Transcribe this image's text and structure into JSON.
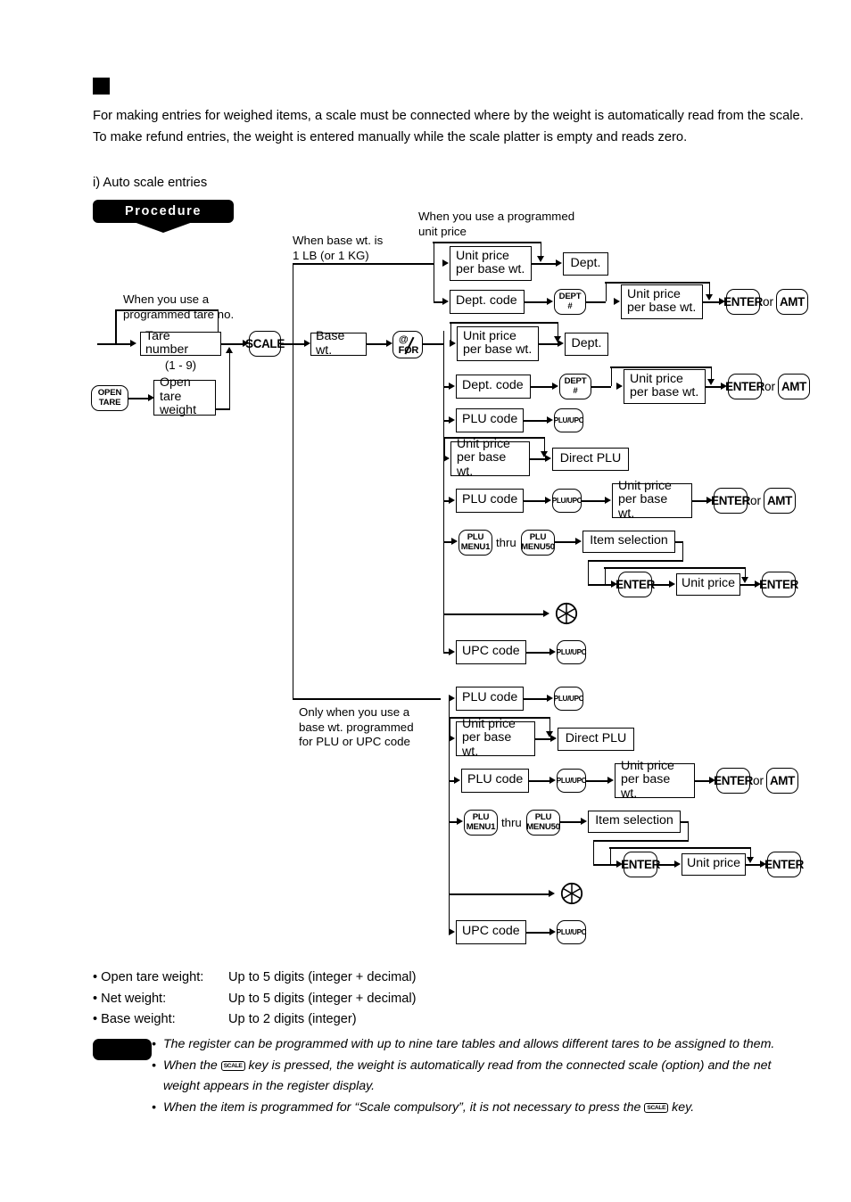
{
  "intro": {
    "paragraph": "For making entries for weighed items, a scale must be connected where by the weight is automatically read from the scale. To make refund entries, the weight is entered manually while the scale platter is empty and reads zero.",
    "sub_label": "i) Auto scale entries"
  },
  "procedure": {
    "banner": "Procedure"
  },
  "flow": {
    "annotations": {
      "tare_note": "When you use a\nprogrammed tare no.",
      "base_wt_note": "When base wt. is\n1 LB (or 1 KG)",
      "unit_price_note": "When you use a programmed\nunit price",
      "base_wt_programmed_note": "Only when you use a\nbase wt. programmed\nfor PLU or UPC code"
    },
    "keys": {
      "open_tare": {
        "l1": "OPEN",
        "l2": "TARE"
      },
      "scale": "SCALE",
      "at_for": {
        "l1": "@",
        "l2": "FOR"
      },
      "dept_hash": {
        "l1": "DEPT",
        "l2": "#"
      },
      "plu_upc": "PLU/UPC",
      "plu_menu1": {
        "l1": "PLU",
        "l2": "MENU1"
      },
      "plu_menu50": {
        "l1": "PLU",
        "l2": "MENU50"
      },
      "enter": "ENTER",
      "amt": "AMT"
    },
    "boxes": {
      "tare_number": "Tare number",
      "tare_range": "(1 - 9)",
      "open_tare_weight": "Open tare\nweight",
      "base_wt": "Base wt.",
      "unit_price_per_base_wt": "Unit price\nper base wt.",
      "dept": "Dept.",
      "dept_code": "Dept. code",
      "plu_code": "PLU code",
      "direct_plu": "Direct PLU",
      "item_selection": "Item selection",
      "unit_price": "Unit price",
      "upc_code": "UPC code"
    },
    "connectors": {
      "thru": "thru",
      "or": "or"
    }
  },
  "specs": [
    {
      "key": "• Open tare weight:",
      "value": "Up to 5 digits (integer + decimal)"
    },
    {
      "key": "• Net weight:",
      "value": "Up to 5 digits (integer + decimal)"
    },
    {
      "key": "• Base weight:",
      "value": "Up to 2 digits (integer)"
    }
  ],
  "notes": {
    "item1": "The register can be programmed with up to nine tare tables and allows different tares to be assigned to them.",
    "item2_a": "When the",
    "item2_key": "SCALE",
    "item2_b": "key is pressed, the weight is automatically read from the connected scale (option) and the net weight appears in the register display.",
    "item3_a": "When the item is programmed for “Scale compulsory”, it is not necessary to press the",
    "item3_key": "SCALE",
    "item3_b": "key."
  }
}
